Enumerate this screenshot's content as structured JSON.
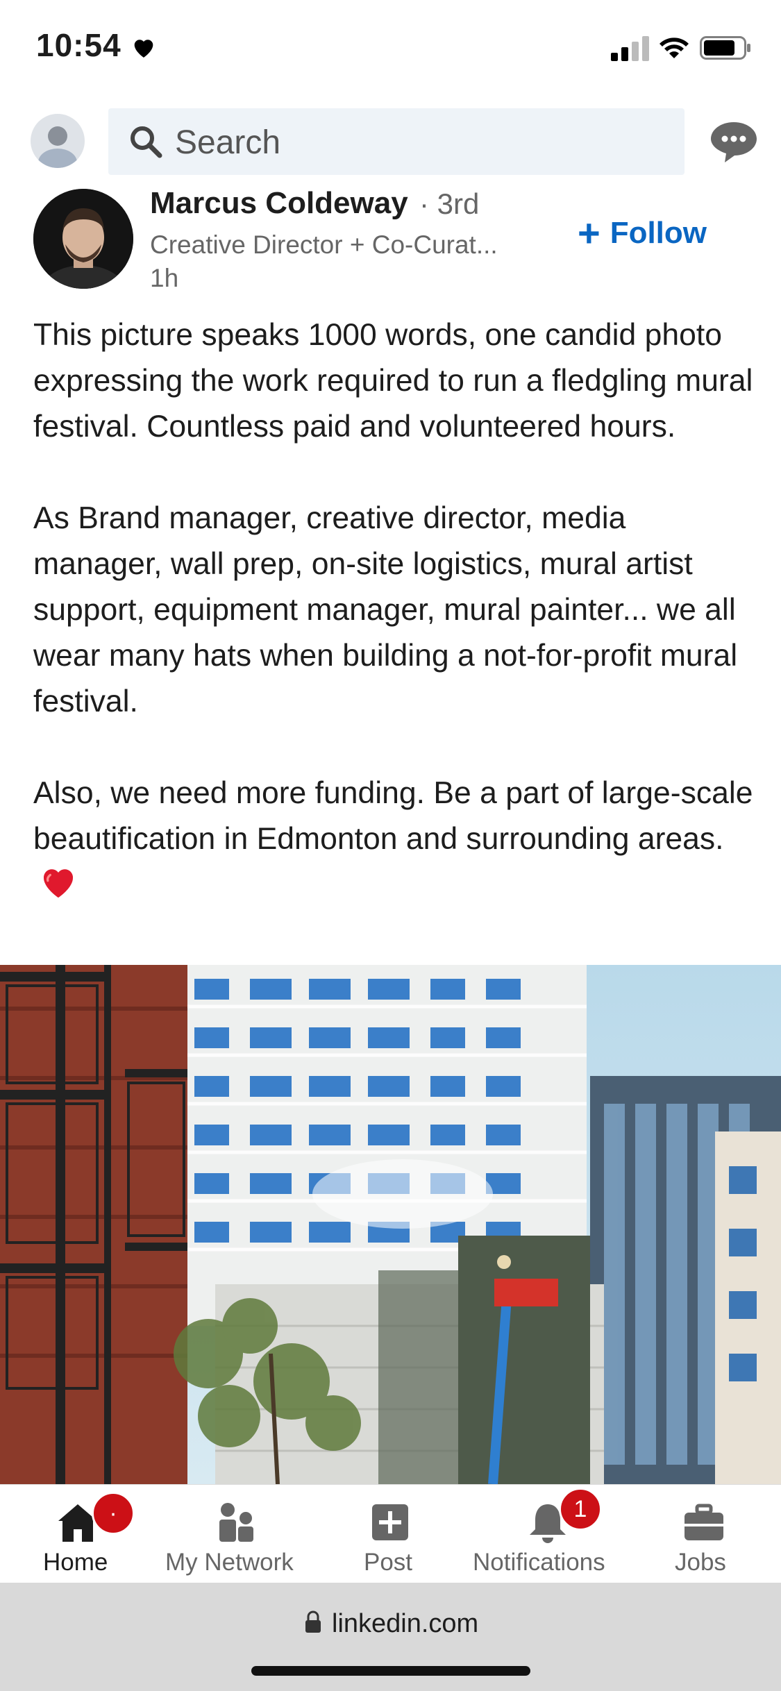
{
  "status_bar": {
    "time": "10:54"
  },
  "top_bar": {
    "search_placeholder": "Search"
  },
  "post": {
    "author_name": "Marcus Coldeway",
    "degree": "· 3rd",
    "headline": "Creative Director + Co-Curat...",
    "time": "1h",
    "follow_label": "Follow",
    "paragraphs": [
      "This picture speaks 1000 words, one candid photo expressing the work required to run a fledgling mural festival. Countless paid and volunteered hours.",
      "As Brand manager, creative director, media manager, wall prep, on-site logistics, mural artist support, equipment manager, mural painter... we all wear many hats when building a not-for-profit mural festival.",
      "Also, we need more funding. Be a part of large-scale beautification in Edmonton and surrounding areas."
    ]
  },
  "bottom_nav": {
    "home": "Home",
    "home_badge": "·",
    "network": "My Network",
    "post": "Post",
    "notifications": "Notifications",
    "notifications_badge": "1",
    "jobs": "Jobs"
  },
  "browser": {
    "url": "linkedin.com"
  },
  "colors": {
    "accent": "#0a66c2",
    "badge": "#cc1016",
    "search_bg": "#eef3f8"
  }
}
